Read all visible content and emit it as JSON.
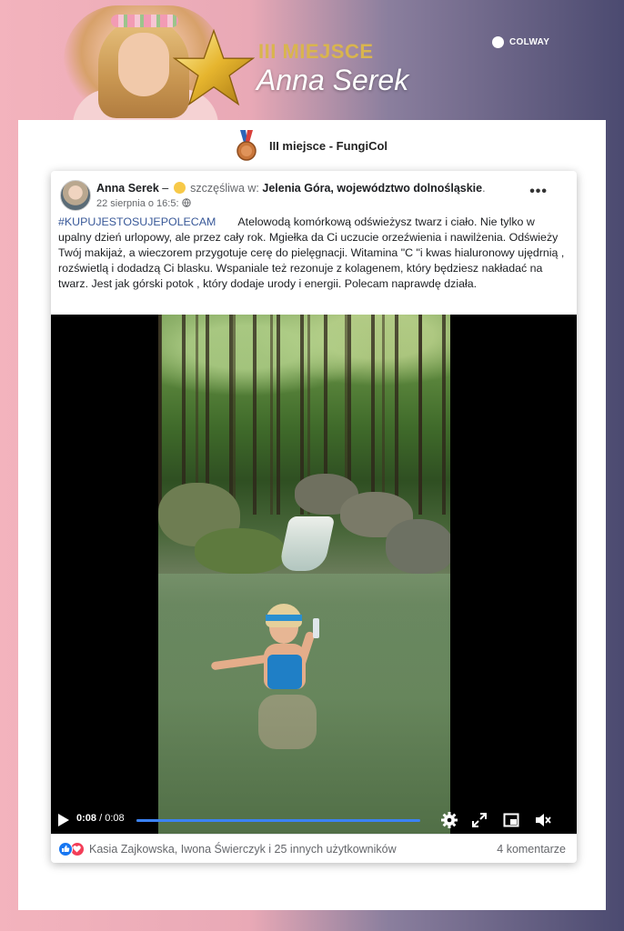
{
  "banner": {
    "place_title": "III MIEJSCE",
    "winner_name": "Anna Serek",
    "brand": "COLWAY"
  },
  "award": {
    "text": "III miejsce - FungiCol"
  },
  "post": {
    "author": "Anna Serek",
    "feeling_prefix": " – ",
    "feeling": "szczęśliwa w:",
    "location": "Jelenia Góra, województwo dolnośląskie",
    "location_suffix": ".",
    "date": "22 sierpnia o 16:5:",
    "privacy_icon": "globe-icon",
    "more_label": "•••",
    "hashtag": "#KUPUJESTOSUJEPOLECAM",
    "body": "Atelowodą  komórkową odświeżysz twarz i ciało. Nie tylko w upalny dzień urlopowy, ale przez cały rok. Mgiełka da Ci uczucie orzeźwienia i nawilżenia. Odświeży   Twój makijaż, a wieczorem przygotuje cerę do pielęgnacji. Witamina \"C \"i kwas hialuronowy ujędrnią , rozświetlą i dodadzą Ci blasku.  Wspaniale też rezonuje z kolagenem, który będziesz nakładać na twarz. Jest jak górski potok , który  dodaje  urody i energii. Polecam  naprawdę działa."
  },
  "video": {
    "current_time": "0:08",
    "separator": " / ",
    "duration": "0:08",
    "progress": 1.0,
    "accent_color": "#3b82f6"
  },
  "reactions": {
    "names": "Kasia Zajkowska, Iwona Świerczyk i 25 innych użytkowników",
    "comments": "4 komentarze"
  }
}
